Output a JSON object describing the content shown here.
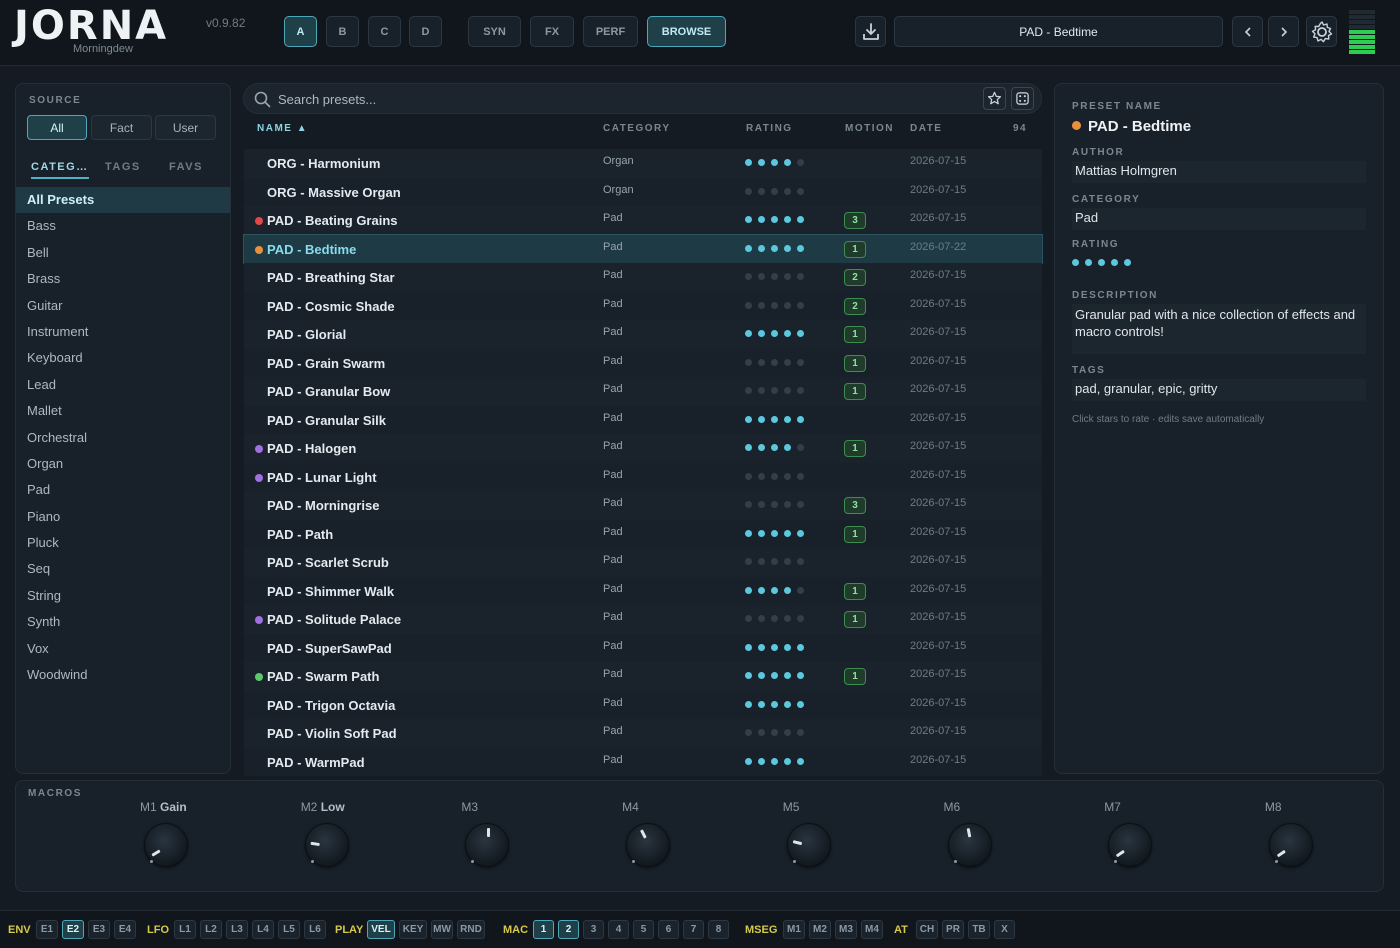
{
  "app": {
    "name": "JORNA",
    "subtitle": "Morningdew",
    "version": "v0.9.82"
  },
  "header": {
    "slots": [
      "A",
      "B",
      "C",
      "D"
    ],
    "active_slot": "A",
    "views": [
      "SYN",
      "FX",
      "PERF",
      "BROWSE"
    ],
    "active_view": "BROWSE",
    "current_preset": "PAD - Bedtime",
    "icons": {
      "save": "download-icon",
      "prev": "chevron-left-icon",
      "next": "chevron-right-icon",
      "settings": "gear-icon"
    }
  },
  "sidebar": {
    "source_label": "SOURCE",
    "sources": [
      "All",
      "Fact",
      "User"
    ],
    "active_source": "All",
    "tabs": [
      "CATEG…",
      "TAGS",
      "FAVS"
    ],
    "active_tab": "CATEG…",
    "categories": [
      "All Presets",
      "Bass",
      "Bell",
      "Brass",
      "Guitar",
      "Instrument",
      "Keyboard",
      "Lead",
      "Mallet",
      "Orchestral",
      "Organ",
      "Pad",
      "Piano",
      "Pluck",
      "Seq",
      "String",
      "Synth",
      "Vox",
      "Woodwind"
    ],
    "active_category": "All Presets"
  },
  "browser": {
    "search_placeholder": "Search presets...",
    "columns": {
      "name": "NAME ▲",
      "category": "CATEGORY",
      "rating": "RATING",
      "motion": "MOTION",
      "date": "DATE"
    },
    "count": "94",
    "presets": [
      {
        "name": "ORG - Harmonium",
        "category": "Organ",
        "rating": 4,
        "motion": "",
        "date": "2026-07-15",
        "color": ""
      },
      {
        "name": "ORG - Massive Organ",
        "category": "Organ",
        "rating": 0,
        "motion": "",
        "date": "2026-07-15",
        "color": ""
      },
      {
        "name": "PAD - Beating Grains",
        "category": "Pad",
        "rating": 5,
        "motion": "3",
        "date": "2026-07-15",
        "color": "#e04848"
      },
      {
        "name": "PAD - Bedtime",
        "category": "Pad",
        "rating": 5,
        "motion": "1",
        "date": "2026-07-22",
        "color": "#e8913a",
        "selected": true
      },
      {
        "name": "PAD - Breathing Star",
        "category": "Pad",
        "rating": 0,
        "motion": "2",
        "date": "2026-07-15",
        "color": ""
      },
      {
        "name": "PAD - Cosmic Shade",
        "category": "Pad",
        "rating": 0,
        "motion": "2",
        "date": "2026-07-15",
        "color": ""
      },
      {
        "name": "PAD - Glorial",
        "category": "Pad",
        "rating": 5,
        "motion": "1",
        "date": "2026-07-15",
        "color": ""
      },
      {
        "name": "PAD - Grain Swarm",
        "category": "Pad",
        "rating": 0,
        "motion": "1",
        "date": "2026-07-15",
        "color": ""
      },
      {
        "name": "PAD - Granular Bow",
        "category": "Pad",
        "rating": 0,
        "motion": "1",
        "date": "2026-07-15",
        "color": ""
      },
      {
        "name": "PAD - Granular Silk",
        "category": "Pad",
        "rating": 5,
        "motion": "",
        "date": "2026-07-15",
        "color": ""
      },
      {
        "name": "PAD - Halogen",
        "category": "Pad",
        "rating": 4,
        "motion": "1",
        "date": "2026-07-15",
        "color": "#a070e0"
      },
      {
        "name": "PAD - Lunar Light",
        "category": "Pad",
        "rating": 0,
        "motion": "",
        "date": "2026-07-15",
        "color": "#a070e0"
      },
      {
        "name": "PAD - Morningrise",
        "category": "Pad",
        "rating": 0,
        "motion": "3",
        "date": "2026-07-15",
        "color": ""
      },
      {
        "name": "PAD - Path",
        "category": "Pad",
        "rating": 5,
        "motion": "1",
        "date": "2026-07-15",
        "color": ""
      },
      {
        "name": "PAD - Scarlet Scrub",
        "category": "Pad",
        "rating": 0,
        "motion": "",
        "date": "2026-07-15",
        "color": ""
      },
      {
        "name": "PAD - Shimmer Walk",
        "category": "Pad",
        "rating": 4,
        "motion": "1",
        "date": "2026-07-15",
        "color": ""
      },
      {
        "name": "PAD - Solitude Palace",
        "category": "Pad",
        "rating": 0,
        "motion": "1",
        "date": "2026-07-15",
        "color": "#a070e0"
      },
      {
        "name": "PAD - SuperSawPad",
        "category": "Pad",
        "rating": 5,
        "motion": "",
        "date": "2026-07-15",
        "color": ""
      },
      {
        "name": "PAD - Swarm Path",
        "category": "Pad",
        "rating": 5,
        "motion": "1",
        "date": "2026-07-15",
        "color": "#5cc86a"
      },
      {
        "name": "PAD - Trigon Octavia",
        "category": "Pad",
        "rating": 5,
        "motion": "",
        "date": "2026-07-15",
        "color": ""
      },
      {
        "name": "PAD - Violin Soft Pad",
        "category": "Pad",
        "rating": 0,
        "motion": "",
        "date": "2026-07-15",
        "color": ""
      },
      {
        "name": "PAD - WarmPad",
        "category": "Pad",
        "rating": 5,
        "motion": "",
        "date": "2026-07-15",
        "color": ""
      }
    ]
  },
  "details": {
    "preset_name_label": "PRESET NAME",
    "preset_name": "PAD - Bedtime",
    "preset_color": "#e8913a",
    "author_label": "AUTHOR",
    "author": "Mattias Holmgren",
    "category_label": "CATEGORY",
    "category": "Pad",
    "rating_label": "RATING",
    "rating": 5,
    "description_label": "DESCRIPTION",
    "description": "Granular pad with a nice collection of effects and macro controls!",
    "tags_label": "TAGS",
    "tags": "pad, granular, epic, gritty",
    "hint": "Click stars to rate · edits save automatically"
  },
  "macros": {
    "label": "MACROS",
    "knobs": [
      {
        "id": "M1",
        "name": "Gain",
        "value": 0.05
      },
      {
        "id": "M2",
        "name": "Low",
        "value": 0.2
      },
      {
        "id": "M3",
        "name": "",
        "value": 0.5
      },
      {
        "id": "M4",
        "name": "",
        "value": 0.4
      },
      {
        "id": "M5",
        "name": "",
        "value": 0.22
      },
      {
        "id": "M6",
        "name": "",
        "value": 0.46
      },
      {
        "id": "M7",
        "name": "",
        "value": 0.04
      },
      {
        "id": "M8",
        "name": "",
        "value": 0.04
      }
    ]
  },
  "modbar": {
    "groups": [
      {
        "label": "ENV",
        "items": [
          "E1",
          "E2",
          "E3",
          "E4"
        ],
        "active": [
          "E2"
        ]
      },
      {
        "label": "LFO",
        "items": [
          "L1",
          "L2",
          "L3",
          "L4",
          "L5",
          "L6"
        ],
        "active": []
      },
      {
        "label": "PLAY",
        "items": [
          "VEL",
          "KEY",
          "MW",
          "RND"
        ],
        "active": [
          "VEL"
        ]
      },
      {
        "label": "MAC",
        "items": [
          "1",
          "2",
          "3",
          "4",
          "5",
          "6",
          "7",
          "8"
        ],
        "active": [
          "1",
          "2"
        ]
      },
      {
        "label": "MSEG",
        "items": [
          "M1",
          "M2",
          "M3",
          "M4"
        ],
        "active": []
      },
      {
        "label": "AT",
        "items": [
          "CH",
          "PR",
          "TB",
          "X"
        ],
        "active": []
      }
    ]
  }
}
